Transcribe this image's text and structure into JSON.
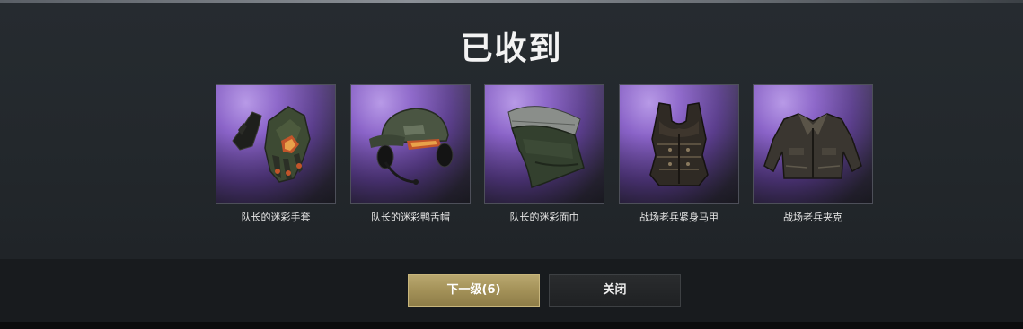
{
  "dialog": {
    "title": "已收到"
  },
  "items": [
    {
      "name": "队长的迷彩手套",
      "icon": "gloves-icon"
    },
    {
      "name": "队长的迷彩鸭舌帽",
      "icon": "cap-headset-icon"
    },
    {
      "name": "队长的迷彩面巾",
      "icon": "face-mask-icon"
    },
    {
      "name": "战场老兵紧身马甲",
      "icon": "vest-icon"
    },
    {
      "name": "战场老兵夹克",
      "icon": "jacket-icon"
    }
  ],
  "buttons": {
    "next_label": "下一级(6)",
    "close_label": "关闭"
  },
  "colors": {
    "rarity_purple": "#8a63c8",
    "accent_gold": "#a39158",
    "panel_bg": "#23282c"
  }
}
